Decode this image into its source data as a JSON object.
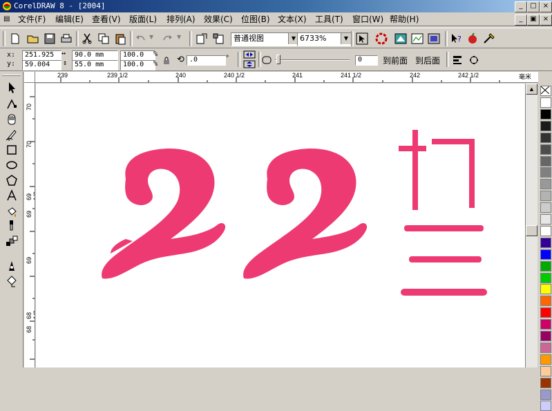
{
  "window": {
    "title": "CorelDRAW 8 - [2004]",
    "buttons": [
      "_",
      "&#9633;",
      "×"
    ]
  },
  "menu": [
    "文件(F)",
    "编辑(E)",
    "查看(V)",
    "版面(L)",
    "排列(A)",
    "效果(C)",
    "位图(B)",
    "文本(X)",
    "工具(T)",
    "窗口(W)",
    "帮助(H)"
  ],
  "toolbar": {
    "view_mode": "普通视图",
    "zoom": "6733%"
  },
  "properties": {
    "x_label": "x:",
    "x_value": "251.925",
    "y_label": "y:",
    "y_value": "59.004",
    "width_value": "90.0 mm",
    "height_value": "55.0 mm",
    "scale_x": "100.0",
    "scale_y": "100.0",
    "percent": "%",
    "rotation": ".0",
    "degree": "°",
    "outline_value": "0",
    "to_front": "到前面",
    "to_back": "到后面"
  },
  "ruler_h": {
    "labels": [
      "239",
      "239 1/2",
      "240",
      "240 1/2",
      "241",
      "241 1/2",
      "242",
      "242 1/2"
    ],
    "unit": "毫米"
  },
  "ruler_v": {
    "labels": [
      "70",
      "70",
      "69 1/2",
      "69",
      "69",
      "68 1/2",
      "68"
    ]
  },
  "artwork": {
    "number": "22",
    "chars": [
      "初",
      "三"
    ],
    "color": "#ee3a72"
  },
  "palette": [
    "#ffffff",
    "#000000",
    "#1a1a1a",
    "#333333",
    "#4d4d4d",
    "#666666",
    "#808080",
    "#999999",
    "#b3b3b3",
    "#cccccc",
    "#e6e6e6",
    "#ffffff",
    "#330099",
    "#0000ff",
    "#00aa00",
    "#00cc00",
    "#ffff00",
    "#ff6600",
    "#ff0000",
    "#cc0066",
    "#990066",
    "#cc6699",
    "#ff9900",
    "#ffcc99",
    "#993300",
    "#9999cc",
    "#ccccff"
  ]
}
